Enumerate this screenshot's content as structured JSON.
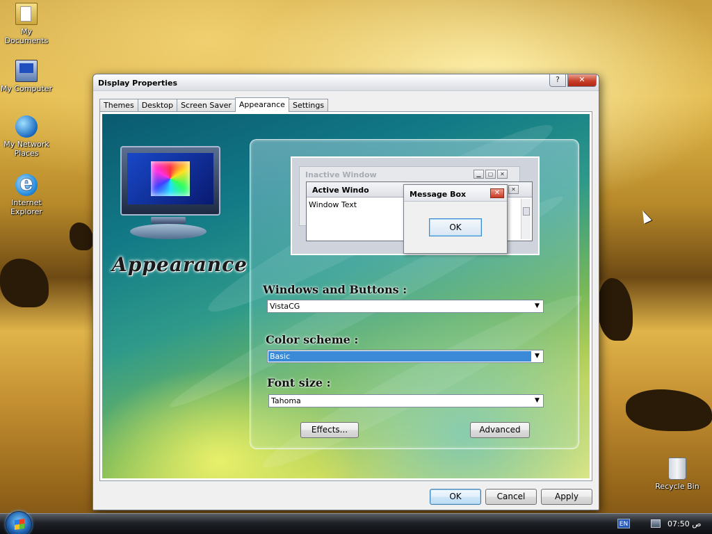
{
  "desktop": {
    "icons": [
      {
        "label": "My Documents",
        "icon": "my-documents-icon"
      },
      {
        "label": "My Computer",
        "icon": "my-computer-icon"
      },
      {
        "label": "My Network Places",
        "icon": "network-places-icon"
      },
      {
        "label": "Internet Explorer",
        "icon": "internet-explorer-icon"
      },
      {
        "label": "Recycle Bin",
        "icon": "recycle-bin-icon"
      }
    ]
  },
  "window": {
    "title": "Display Properties",
    "help_glyph": "?",
    "close_glyph": "✕",
    "tabs": [
      {
        "label": "Themes",
        "active": false
      },
      {
        "label": "Desktop",
        "active": false
      },
      {
        "label": "Screen Saver",
        "active": false
      },
      {
        "label": "Appearance",
        "active": true
      },
      {
        "label": "Settings",
        "active": false
      }
    ],
    "heading": "Appearance",
    "preview": {
      "inactive_title": "Inactive Window",
      "active_title": "Active Windo",
      "window_text": "Window Text",
      "message_title": "Message Box",
      "message_close": "✕",
      "message_ok": "OK"
    },
    "windows_buttons": {
      "label": "Windows and Buttons :",
      "value": "VistaCG"
    },
    "color_scheme": {
      "label": "Color scheme :",
      "value": "Basic"
    },
    "font_size": {
      "label": "Font size :",
      "value": "Tahoma"
    },
    "effects_button": "Effects...",
    "advanced_button": "Advanced",
    "footer": {
      "ok": "OK",
      "cancel": "Cancel",
      "apply": "Apply"
    }
  },
  "taskbar": {
    "language": "EN",
    "clock": "ص 07:50"
  },
  "colors": {
    "accent": "#3a8ad8",
    "close_red": "#c8402a"
  }
}
